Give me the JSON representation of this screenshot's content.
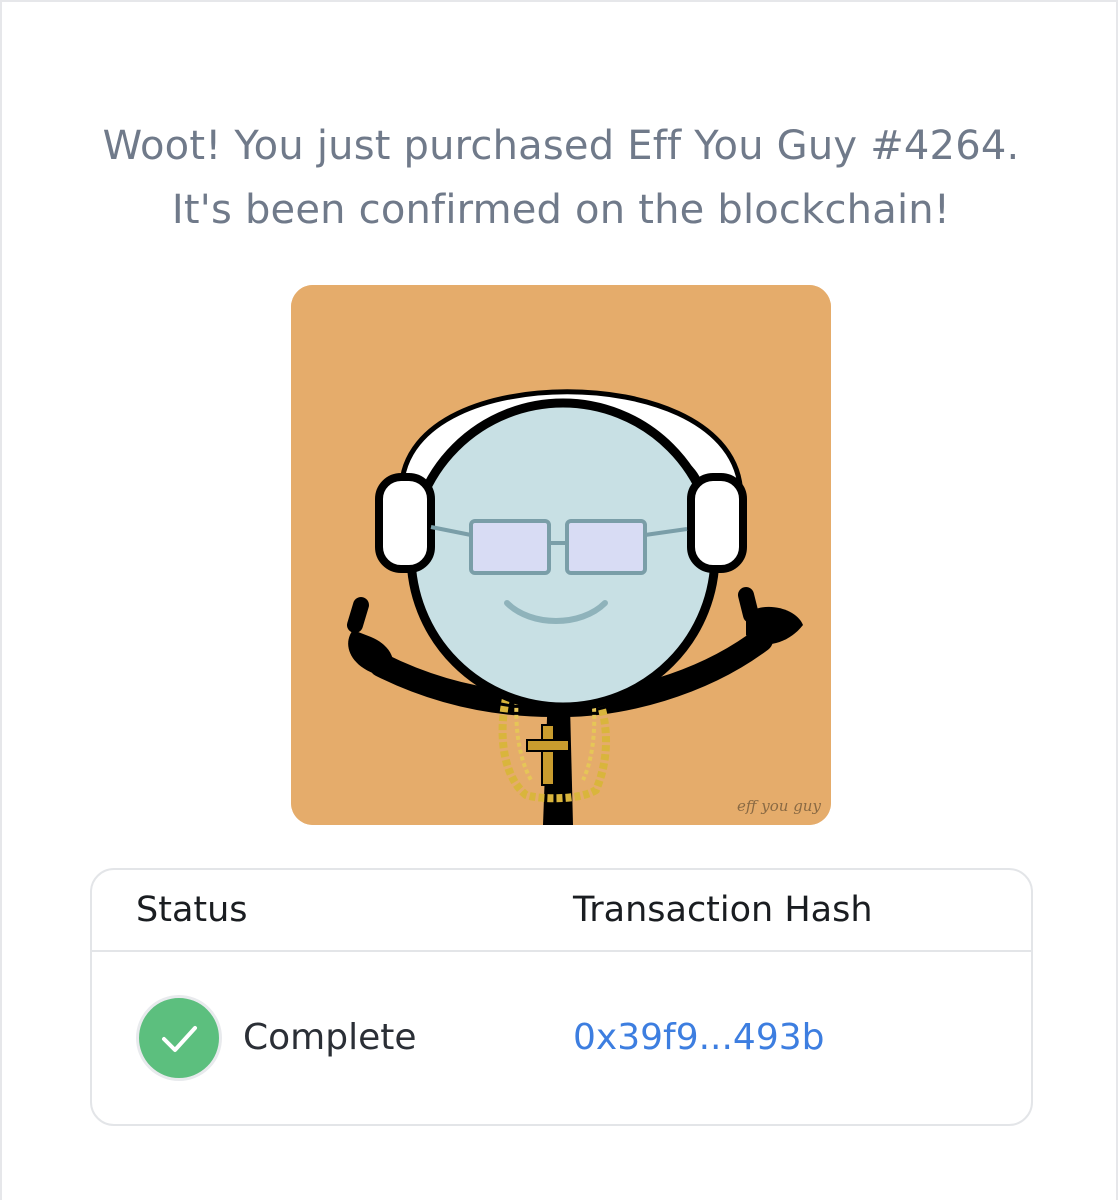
{
  "message": {
    "line1": "Woot! You just purchased Eff You Guy #4264.",
    "line2": "It's been confirmed on the blockchain!"
  },
  "nft": {
    "signature": "eff you guy",
    "background_color": "#e5ac6b"
  },
  "table": {
    "status_header": "Status",
    "hash_header": "Transaction Hash",
    "status_value": "Complete",
    "hash_value": "0x39f9...493b"
  },
  "colors": {
    "success": "#5cbf7e",
    "link": "#3d7ee0",
    "text_muted": "#707a8a"
  },
  "icons": {
    "status": "check-circle-icon"
  }
}
